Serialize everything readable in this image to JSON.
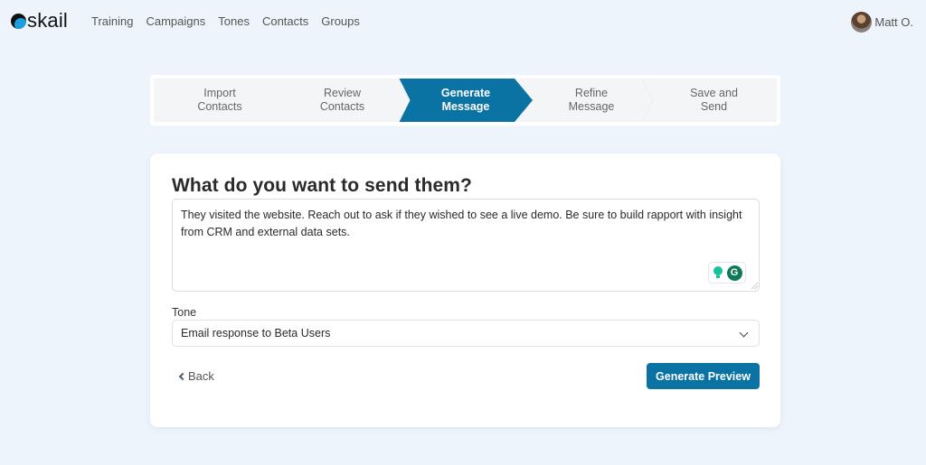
{
  "app": {
    "logo_text": "skail",
    "brand_color": "#0a73a3"
  },
  "nav": {
    "links": [
      "Training",
      "Campaigns",
      "Tones",
      "Contacts",
      "Groups"
    ]
  },
  "user": {
    "name": "Matt O."
  },
  "stepper": {
    "active_index": 2,
    "steps": [
      {
        "line1": "Import",
        "line2": "Contacts"
      },
      {
        "line1": "Review",
        "line2": "Contacts"
      },
      {
        "line1": "Generate",
        "line2": "Message"
      },
      {
        "line1": "Refine",
        "line2": "Message"
      },
      {
        "line1": "Save and",
        "line2": "Send"
      }
    ]
  },
  "form": {
    "title": "What do you want to send them?",
    "message_value": "They visited the website. Reach out to ask if they wished to see a live demo. Be sure to build rapport with insight from CRM and external data sets.",
    "tone_label": "Tone",
    "tone_selected": "Email response to Beta Users",
    "back_label": "Back",
    "generate_label": "Generate Preview"
  }
}
